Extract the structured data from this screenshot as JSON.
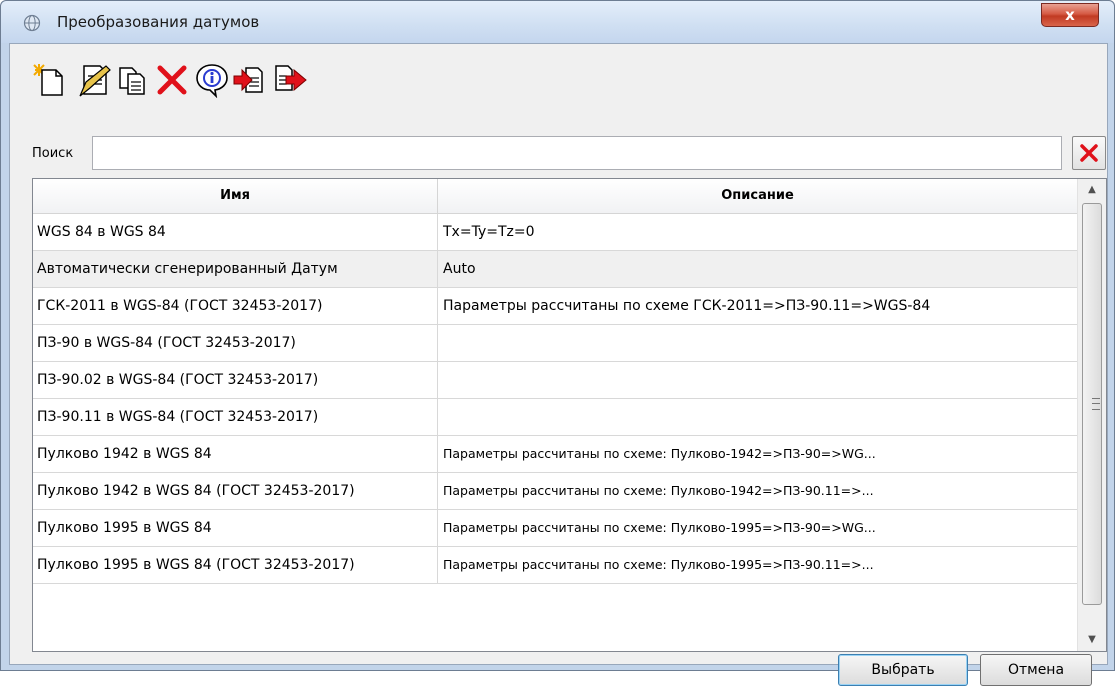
{
  "window": {
    "title": "Преобразования датумов",
    "close_label": "x"
  },
  "toolbar": {
    "items": [
      {
        "icon": "new-icon"
      },
      {
        "icon": "edit-icon"
      },
      {
        "icon": "copy-icon"
      },
      {
        "icon": "delete-icon"
      },
      {
        "icon": "info-icon"
      },
      {
        "icon": "import-icon"
      },
      {
        "icon": "export-icon"
      }
    ]
  },
  "search": {
    "label": "Поиск",
    "value": "",
    "placeholder": ""
  },
  "table": {
    "columns": [
      "Имя",
      "Описание"
    ],
    "selected_row": 1,
    "rows": [
      {
        "name": "WGS 84 в WGS 84",
        "desc": "Tx=Ty=Tz=0"
      },
      {
        "name": "Автоматически сгенерированный Датум",
        "desc": "Auto"
      },
      {
        "name": "ГСК-2011 в WGS-84 (ГОСТ 32453-2017)",
        "desc": "Параметры рассчитаны по схеме ГСК-2011=>ПЗ-90.11=>WGS-84"
      },
      {
        "name": "ПЗ-90 в WGS-84 (ГОСТ 32453-2017)",
        "desc": ""
      },
      {
        "name": "ПЗ-90.02 в WGS-84 (ГОСТ 32453-2017)",
        "desc": ""
      },
      {
        "name": "ПЗ-90.11 в WGS-84 (ГОСТ 32453-2017)",
        "desc": ""
      },
      {
        "name": "Пулково 1942 в WGS 84",
        "desc": "Параметры рассчитаны по схеме: Пулково-1942=>ПЗ-90=>WG..."
      },
      {
        "name": "Пулково 1942 в WGS 84 (ГОСТ 32453-2017)",
        "desc": "Параметры рассчитаны по схеме: Пулково-1942=>ПЗ-90.11=>..."
      },
      {
        "name": "Пулково 1995 в WGS 84",
        "desc": "Параметры рассчитаны по схеме: Пулково-1995=>ПЗ-90=>WG..."
      },
      {
        "name": "Пулково 1995 в WGS 84 (ГОСТ 32453-2017)",
        "desc": "Параметры рассчитаны по схеме: Пулково-1995=>ПЗ-90.11=>..."
      }
    ]
  },
  "buttons": {
    "select": "Выбрать",
    "cancel": "Отмена"
  }
}
